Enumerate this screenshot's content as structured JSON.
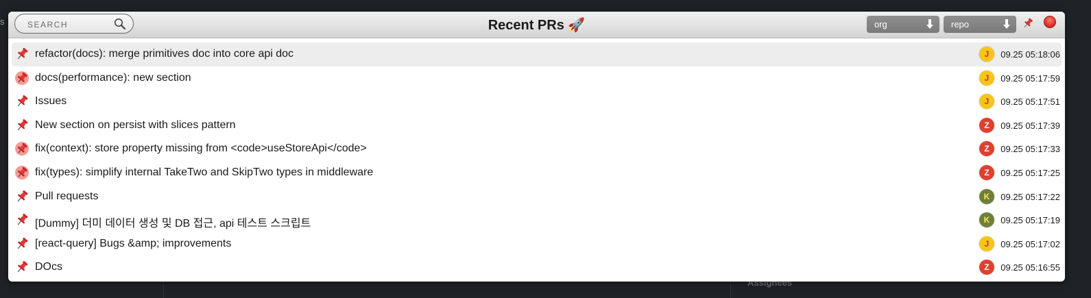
{
  "background": {
    "left_fragment": "s",
    "assignees_label": "Assignees"
  },
  "window": {
    "title": "Recent PRs 🚀",
    "search": {
      "placeholder": "SEARCH",
      "icon": "magnifier-icon"
    },
    "org_dropdown": {
      "label": "org",
      "icon": "arrow-down-icon"
    },
    "repo_dropdown": {
      "label": "repo",
      "icon": "arrow-down-icon"
    },
    "pin_button_icon": "pushpin-icon",
    "close_button_icon": "red-close-icon"
  },
  "colors": {
    "pin_red": "#d32f2f",
    "close_red": "#e0332a",
    "avatar_yellow": "#f5c518",
    "avatar_red": "#e0402f",
    "avatar_olive": "#6e7f3a",
    "selected_row": "#ededed"
  },
  "prs": [
    {
      "title": "refactor(docs): merge primitives doc into core api doc",
      "author_initial": "J",
      "avatar_color": "#f5c518",
      "initial_color": "#c0392b",
      "timestamp": "09.25 05:18:06",
      "pin_state": "pinned",
      "selected": true
    },
    {
      "title": "docs(performance): new section",
      "author_initial": "J",
      "avatar_color": "#f5c518",
      "initial_color": "#c0392b",
      "timestamp": "09.25 05:17:59",
      "pin_state": "highlighted"
    },
    {
      "title": "Issues",
      "author_initial": "J",
      "avatar_color": "#f5c518",
      "initial_color": "#c0392b",
      "timestamp": "09.25 05:17:51",
      "pin_state": "pinned"
    },
    {
      "title": "New section on persist with slices pattern",
      "author_initial": "Z",
      "avatar_color": "#e0402f",
      "initial_color": "#ffffff",
      "timestamp": "09.25 05:17:39",
      "pin_state": "pinned"
    },
    {
      "title": "fix(context): store property missing from <code>useStoreApi</code>",
      "author_initial": "Z",
      "avatar_color": "#e0402f",
      "initial_color": "#ffffff",
      "timestamp": "09.25 05:17:33",
      "pin_state": "highlighted"
    },
    {
      "title": "fix(types): simplify internal TakeTwo and SkipTwo types in middleware",
      "author_initial": "Z",
      "avatar_color": "#e0402f",
      "initial_color": "#ffffff",
      "timestamp": "09.25 05:17:25",
      "pin_state": "highlighted"
    },
    {
      "title": "Pull requests",
      "author_initial": "K",
      "avatar_color": "#6e7f3a",
      "initial_color": "#f5e663",
      "timestamp": "09.25 05:17:22",
      "pin_state": "pinned"
    },
    {
      "title": "[Dummy] 더미 데이터 생성 및 DB 접근, api 테스트 스크립트",
      "author_initial": "K",
      "avatar_color": "#6e7f3a",
      "initial_color": "#f5e663",
      "timestamp": "09.25 05:17:19",
      "pin_state": "pinned"
    },
    {
      "title": "[react-query] Bugs &amp; improvements",
      "author_initial": "J",
      "avatar_color": "#f5c518",
      "initial_color": "#c0392b",
      "timestamp": "09.25 05:17:02",
      "pin_state": "pinned"
    },
    {
      "title": "DOcs",
      "author_initial": "Z",
      "avatar_color": "#e0402f",
      "initial_color": "#ffffff",
      "timestamp": "09.25 05:16:55",
      "pin_state": "pinned"
    }
  ]
}
